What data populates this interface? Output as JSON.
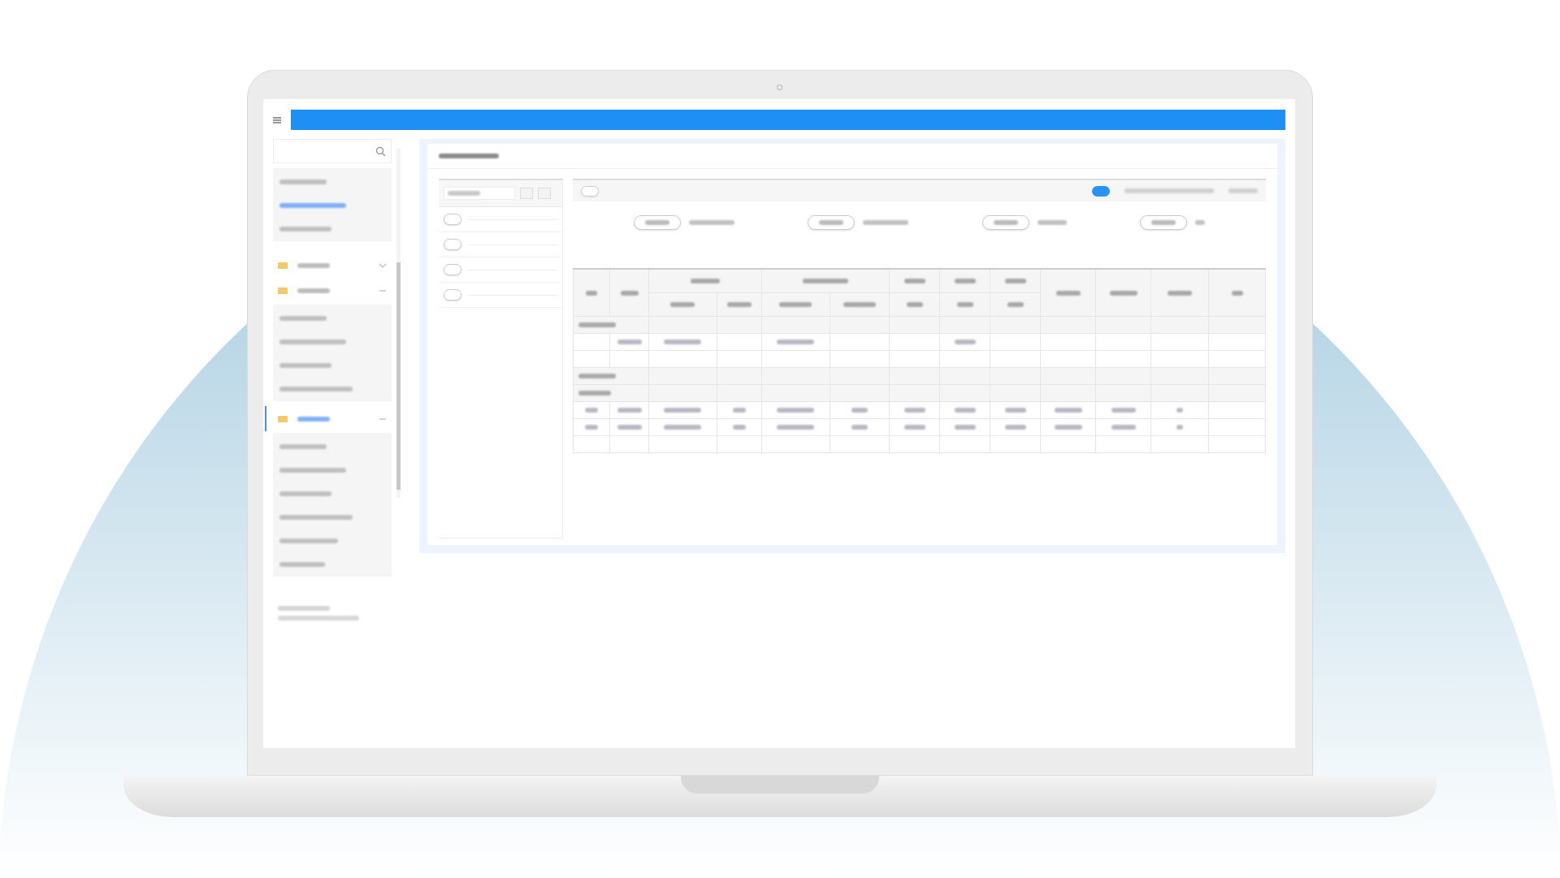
{
  "screen": {
    "top_bar": {
      "kind": "bar"
    },
    "sidebar": {
      "search": {
        "kind": "field"
      },
      "menu": [
        {
          "kind": "list",
          "items": [
            {
              "selected": false
            },
            {
              "selected": true
            },
            {
              "selected": false
            }
          ]
        },
        {
          "kind": "group",
          "selected": false,
          "expanded": false
        },
        {
          "kind": "group",
          "selected": false,
          "expanded": true,
          "items": [
            {
              "selected": false
            },
            {
              "selected": false
            },
            {
              "selected": false
            },
            {
              "selected": false
            }
          ]
        },
        {
          "kind": "group",
          "selected": true,
          "expanded": true,
          "items": [
            {
              "selected": false
            },
            {
              "selected": false
            },
            {
              "selected": false
            },
            {
              "selected": false
            },
            {
              "selected": false
            },
            {
              "selected": false
            }
          ]
        }
      ]
    },
    "list_panel": {
      "rows": [
        {
          "kind": "entry"
        },
        {
          "kind": "entry"
        },
        {
          "kind": "entry"
        },
        {
          "kind": "entry"
        }
      ]
    },
    "report": {
      "toggle": {
        "on": true
      },
      "summary": [
        {
          "kind": "pill"
        },
        {
          "kind": "pill"
        },
        {
          "kind": "pill"
        },
        {
          "kind": "pill"
        }
      ],
      "table": {
        "rows": [
          {
            "kind": "section"
          },
          {
            "kind": "data",
            "text_shown": [
              false,
              true,
              true,
              false,
              true,
              false,
              false,
              true,
              false,
              false,
              false,
              false,
              false
            ]
          },
          {
            "kind": "blank"
          },
          {
            "kind": "section"
          },
          {
            "kind": "subsection"
          },
          {
            "kind": "data",
            "text_shown": [
              true,
              true,
              true,
              true,
              true,
              true,
              true,
              true,
              true,
              true,
              true,
              true,
              false
            ]
          },
          {
            "kind": "data",
            "text_shown": [
              true,
              true,
              true,
              true,
              true,
              true,
              true,
              true,
              true,
              true,
              true,
              true,
              false
            ]
          },
          {
            "kind": "blank"
          }
        ]
      }
    }
  }
}
